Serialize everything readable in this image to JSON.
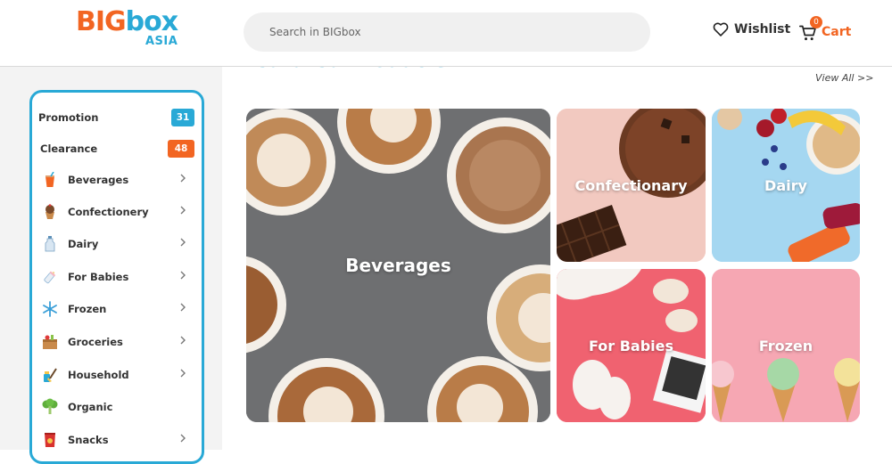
{
  "header": {
    "logo": {
      "brand_part1": "BIG",
      "brand_part2": "box",
      "sub": "ASIA"
    },
    "search": {
      "placeholder": "Search in BIGbox",
      "value": ""
    },
    "wishlist_label": "Wishlist",
    "cart_label": "Cart",
    "cart_count": "0"
  },
  "sidebar": {
    "promotion": {
      "label": "Promotion",
      "count": "31",
      "color": "#29a9d6"
    },
    "clearance": {
      "label": "Clearance",
      "count": "48",
      "color": "#f26522"
    },
    "items": [
      {
        "label": "Beverages",
        "icon": "beverage-icon",
        "chevron": true
      },
      {
        "label": "Confectionery",
        "icon": "cupcake-icon",
        "chevron": true
      },
      {
        "label": "Dairy",
        "icon": "milk-bottle-icon",
        "chevron": true
      },
      {
        "label": "For Babies",
        "icon": "baby-bottle-icon",
        "chevron": true
      },
      {
        "label": "Frozen",
        "icon": "snowflake-icon",
        "chevron": true
      },
      {
        "label": "Groceries",
        "icon": "grocery-box-icon",
        "chevron": true
      },
      {
        "label": "Household",
        "icon": "cleaning-icon",
        "chevron": true
      },
      {
        "label": "Organic",
        "icon": "broccoli-icon",
        "chevron": false
      },
      {
        "label": "Snacks",
        "icon": "chips-icon",
        "chevron": true
      }
    ]
  },
  "main": {
    "section_title": "Featured Products",
    "view_all": "View All >>",
    "tiles": [
      {
        "label": "Beverages",
        "bg": "#6f7072"
      },
      {
        "label": "Confectionary",
        "bg": "#f3c8bf"
      },
      {
        "label": "Dairy",
        "bg": "#9ed4f0"
      },
      {
        "label": "For Babies",
        "bg": "#f0606e"
      },
      {
        "label": "Frozen",
        "bg": "#f7a5b1"
      }
    ]
  },
  "colors": {
    "accent_blue": "#29a9d6",
    "accent_orange": "#f26522"
  }
}
